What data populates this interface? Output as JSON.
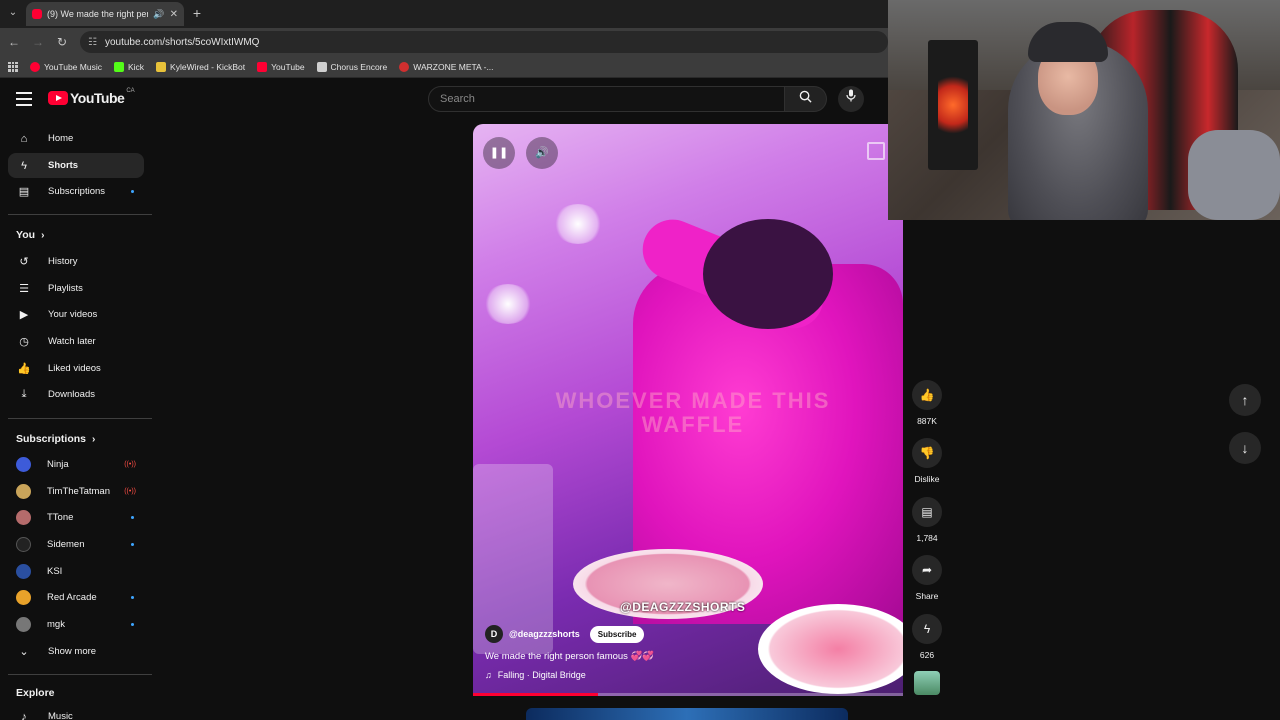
{
  "browser": {
    "tab_title": "(9) We made the right pers",
    "url": "youtube.com/shorts/5coWIxtIWMQ",
    "bookmarks": [
      {
        "label": "YouTube Music",
        "color": "#ff0033"
      },
      {
        "label": "Kick",
        "color": "#53fc18"
      },
      {
        "label": "KyleWired - KickBot",
        "color": "#e8c23a"
      },
      {
        "label": "YouTube",
        "color": "#ff0033"
      },
      {
        "label": "Chorus Encore",
        "color": "#cfcfcf"
      },
      {
        "label": "WARZONE META -...",
        "color": "#d02f2f"
      }
    ]
  },
  "header": {
    "logo_text": "YouTube",
    "region": "CA",
    "search_placeholder": "Search"
  },
  "sidebar": {
    "main": [
      {
        "label": "Home",
        "icon": "home-icon"
      },
      {
        "label": "Shorts",
        "icon": "shorts-icon",
        "active": true
      },
      {
        "label": "Subscriptions",
        "icon": "subscriptions-icon"
      }
    ],
    "you_heading": "You",
    "you": [
      {
        "label": "History",
        "icon": "history-icon"
      },
      {
        "label": "Playlists",
        "icon": "playlists-icon"
      },
      {
        "label": "Your videos",
        "icon": "your-videos-icon"
      },
      {
        "label": "Watch later",
        "icon": "watch-later-icon"
      },
      {
        "label": "Liked videos",
        "icon": "liked-videos-icon"
      },
      {
        "label": "Downloads",
        "icon": "downloads-icon"
      }
    ],
    "subscriptions_heading": "Subscriptions",
    "subscriptions": [
      {
        "label": "Ninja",
        "color": "#3d5bd9",
        "live": true
      },
      {
        "label": "TimTheTatman",
        "color": "#c9a45a",
        "live": true
      },
      {
        "label": "TTone",
        "color": "#b56b6b"
      },
      {
        "label": "Sidemen",
        "color": "#222222"
      },
      {
        "label": "KSI",
        "color": "#2a4fa0"
      },
      {
        "label": "Red Arcade",
        "color": "#e8a22a"
      },
      {
        "label": "mgk",
        "color": "#777777"
      }
    ],
    "show_more": "Show more",
    "explore_heading": "Explore",
    "explore": [
      {
        "label": "Music",
        "icon": "music-icon"
      }
    ]
  },
  "short": {
    "overlay_text": "WHOEVER MADE THIS WAFFLE",
    "watermark": "@DEAGZZZSHORTS",
    "channel_initial": "D",
    "channel": "@deagzzzshorts",
    "subscribe_label": "Subscribe",
    "title": "We made the right person famous",
    "title_emoji": "💞💞",
    "music": "Falling · Digital Bridge",
    "progress": 0.29
  },
  "actions": {
    "like_count": "887K",
    "dislike_label": "Dislike",
    "comment_count": "1,784",
    "share_label": "Share",
    "remix_count": "626"
  },
  "colors": {
    "accent": "#ff0033",
    "background": "#0f0f0f"
  }
}
